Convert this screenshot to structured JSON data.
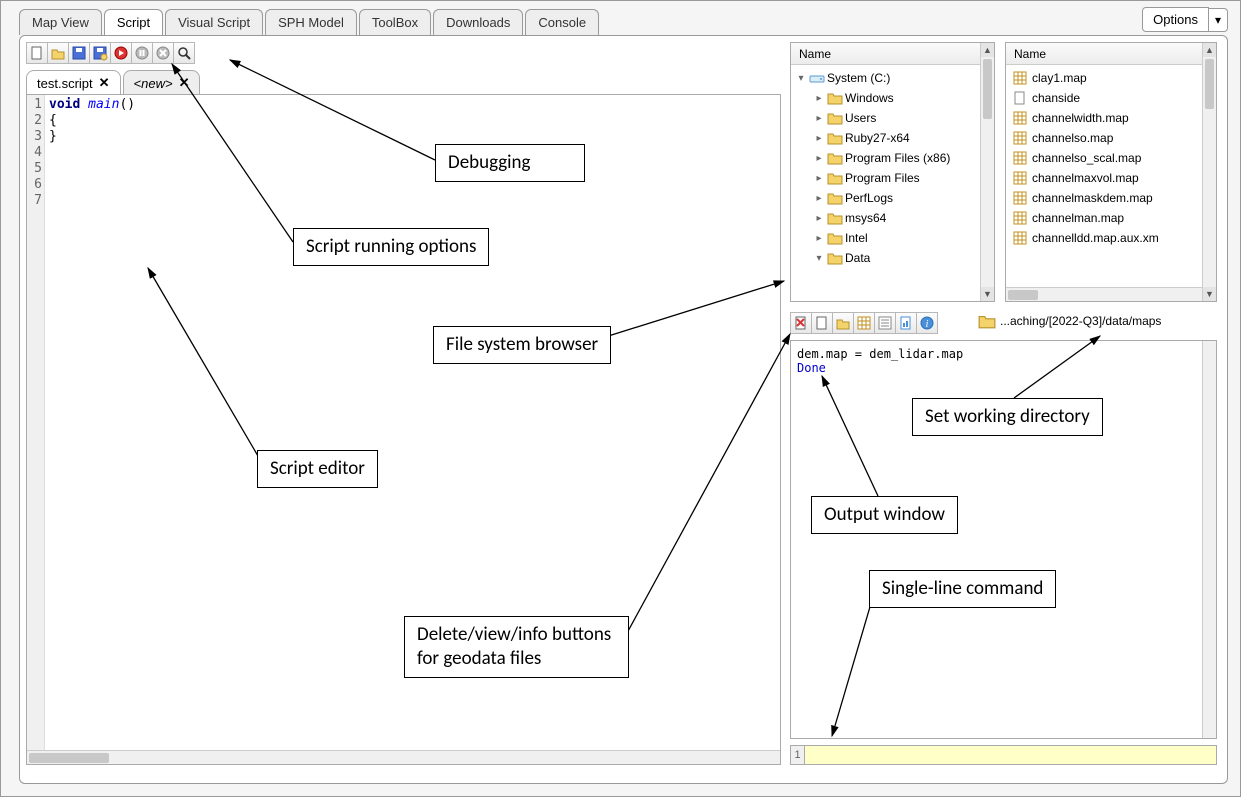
{
  "tabs": [
    "Map View",
    "Script",
    "Visual Script",
    "SPH Model",
    "ToolBox",
    "Downloads",
    "Console"
  ],
  "active_tab": 1,
  "options_label": "Options",
  "toolbar_icons": [
    "new",
    "open",
    "save",
    "saveas",
    "run",
    "pause",
    "stop",
    "debug"
  ],
  "editor_tabs": [
    {
      "label": "test.script",
      "italic": false
    },
    {
      "label": "<new>",
      "italic": true
    }
  ],
  "editor_lines": [
    {
      "n": 1,
      "tokens": [
        [
          "kw",
          "void "
        ],
        [
          "fn",
          "main"
        ],
        [
          "",
          "()"
        ]
      ]
    },
    {
      "n": 2,
      "tokens": [
        [
          "",
          "{"
        ]
      ]
    },
    {
      "n": 3,
      "tokens": [
        [
          "",
          ""
        ]
      ]
    },
    {
      "n": 4,
      "tokens": [
        [
          "",
          ""
        ]
      ]
    },
    {
      "n": 5,
      "tokens": [
        [
          "",
          ""
        ]
      ]
    },
    {
      "n": 6,
      "tokens": [
        [
          "",
          "}"
        ]
      ]
    },
    {
      "n": 7,
      "tokens": [
        [
          "",
          ""
        ]
      ]
    }
  ],
  "fs_tree_header": "Name",
  "fs_tree": [
    {
      "depth": 0,
      "expander": "▾",
      "icon": "drive",
      "label": "System (C:)"
    },
    {
      "depth": 1,
      "expander": "▸",
      "icon": "folder",
      "label": "Windows"
    },
    {
      "depth": 1,
      "expander": "▸",
      "icon": "folder",
      "label": "Users"
    },
    {
      "depth": 1,
      "expander": "▸",
      "icon": "folder",
      "label": "Ruby27-x64"
    },
    {
      "depth": 1,
      "expander": "▸",
      "icon": "folder",
      "label": "Program Files (x86)"
    },
    {
      "depth": 1,
      "expander": "▸",
      "icon": "folder",
      "label": "Program Files"
    },
    {
      "depth": 1,
      "expander": "▸",
      "icon": "folder",
      "label": "PerfLogs"
    },
    {
      "depth": 1,
      "expander": "▸",
      "icon": "folder",
      "label": "msys64"
    },
    {
      "depth": 1,
      "expander": "▸",
      "icon": "folder",
      "label": "Intel"
    },
    {
      "depth": 1,
      "expander": "▾",
      "icon": "folder",
      "label": "Data"
    }
  ],
  "fs_list_header": "Name",
  "fs_list": [
    {
      "icon": "map",
      "label": "clay1.map"
    },
    {
      "icon": "file",
      "label": "chanside"
    },
    {
      "icon": "map",
      "label": "channelwidth.map"
    },
    {
      "icon": "map",
      "label": "channelso.map"
    },
    {
      "icon": "map",
      "label": "channelso_scal.map"
    },
    {
      "icon": "map",
      "label": "channelmaxvol.map"
    },
    {
      "icon": "map",
      "label": "channelmaskdem.map"
    },
    {
      "icon": "map",
      "label": "channelman.map"
    },
    {
      "icon": "map",
      "label": "channelldd.map.aux.xm"
    }
  ],
  "right_toolbar": [
    "delete",
    "new",
    "open",
    "table",
    "attrs",
    "report",
    "info"
  ],
  "working_dir": "...aching/[2022-Q3]/data/maps",
  "output": {
    "line1": "dem.map = dem_lidar.map",
    "line2": "Done"
  },
  "cmd_line_number": "1",
  "cmd_value": "",
  "annotations": {
    "debugging": "Debugging",
    "running": "Script running options",
    "fs": "File system browser",
    "editor": "Script editor",
    "geodata": "Delete/view/info buttons for geodata files",
    "wd": "Set working directory",
    "output": "Output window",
    "cmd": "Single-line command"
  }
}
